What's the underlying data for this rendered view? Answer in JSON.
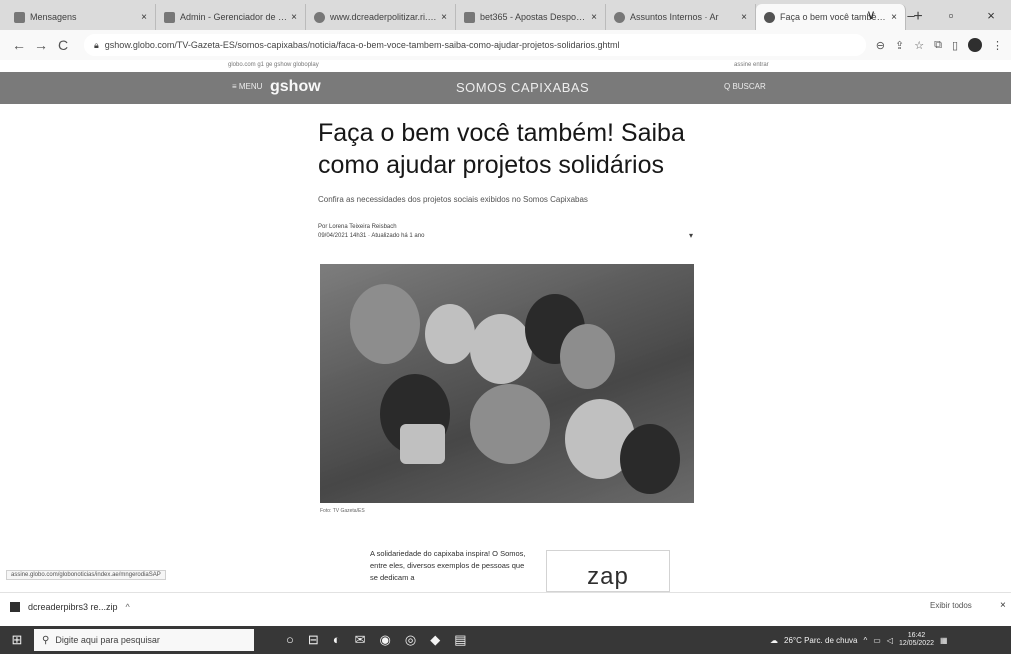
{
  "browser": {
    "tabs": [
      {
        "label": "Mensagens",
        "icon": "chat-icon"
      },
      {
        "label": "Admin - Gerenciador de Cont",
        "icon": "doc-icon"
      },
      {
        "label": "www.dcreaderpolitizar.ri.gov.b",
        "icon": "globe-icon"
      },
      {
        "label": "bet365 - Apostas Desportivas",
        "icon": "grid-icon"
      },
      {
        "label": "Assuntos Internos · Ar",
        "icon": "globe-icon"
      },
      {
        "label": "Faça o bem você também! Sai",
        "icon": "globo-icon",
        "active": true
      }
    ],
    "new_tab": "+",
    "window_controls": {
      "dropdown": "∨",
      "minimize": "–",
      "maximize": "▫",
      "close": "×"
    },
    "back": "←",
    "forward": "→",
    "reload": "C",
    "url": "gshow.globo.com/TV-Gazeta-ES/somos-capixabas/noticia/faca-o-bem-voce-tambem-saiba-como-ajudar-projetos-solidarios.ghtml"
  },
  "globo_bar": {
    "left": "globo.com  g1  ge  gshow  globoplay",
    "right": "assine  entrar"
  },
  "gshow_header": {
    "menu": "≡ MENU",
    "logo": "gshow",
    "section": "SOMOS CAPIXABAS",
    "search": "Q BUSCAR"
  },
  "article": {
    "headline": "Faça o bem você também! Saiba como ajudar projetos solidários",
    "subhead": "Confira as necessidades dos projetos sociais exibidos no Somos Capixabas",
    "byline_author": "Por Lorena Teixeira Reisbach",
    "byline_date": "09/04/2021 14h31 · Atualizado há 1 ano",
    "photo_caption": "Foto: TV Gazeta/ES",
    "body_text": "A solidariedade do capixaba inspira! O Somos, entre eles, diversos exemplos de pessoas que se dedicam a",
    "ad_text": "zap"
  },
  "status_url": "assine.globo.com/globonoticias/index.ae/mngerodiaSAP",
  "downloads": {
    "item": "dcreaderpibrs3 re...zip",
    "show_all": "Exibir todos",
    "close": "×"
  },
  "taskbar": {
    "search_placeholder": "Digite aqui para pesquisar",
    "weather": "26°C  Parc. de chuva",
    "time": "16:42",
    "date": "12/05/2022"
  }
}
